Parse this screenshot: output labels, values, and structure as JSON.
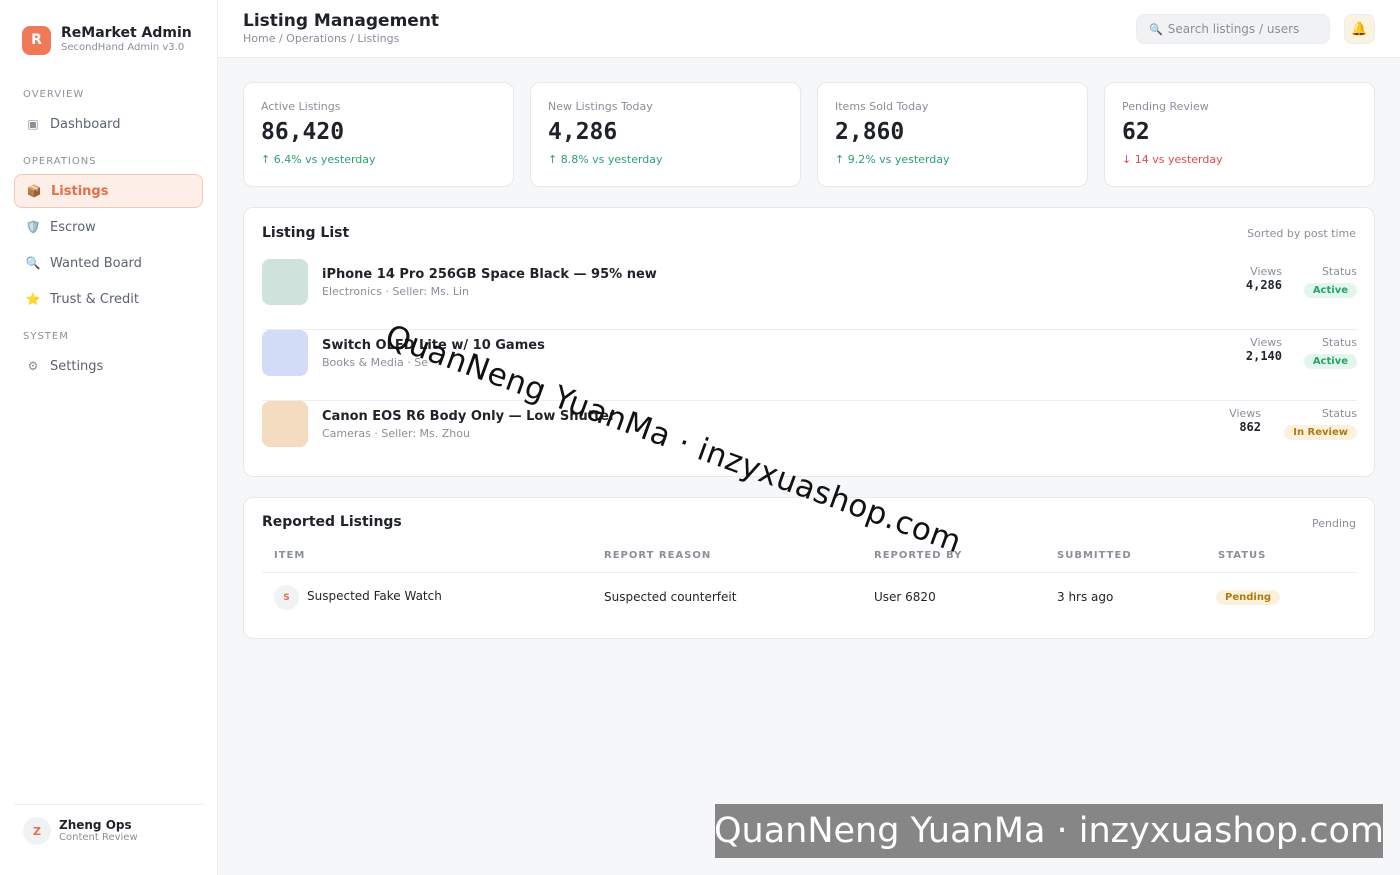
{
  "brand": {
    "logo_letter": "R",
    "name": "ReMarket Admin",
    "subtitle": "SecondHand Admin v3.0"
  },
  "sidebar": {
    "sections": [
      "OVERVIEW",
      "OPERATIONS",
      "SYSTEM"
    ],
    "items": [
      {
        "label": "Dashboard",
        "icon": "dashboard-icon",
        "glyph": "▣"
      },
      {
        "label": "Listings",
        "icon": "package-icon",
        "glyph": "📦",
        "active": true
      },
      {
        "label": "Escrow",
        "icon": "shield-icon",
        "glyph": "🛡️"
      },
      {
        "label": "Wanted Board",
        "icon": "search-icon",
        "glyph": "🔍"
      },
      {
        "label": "Trust & Credit",
        "icon": "star-icon",
        "glyph": "⭐"
      },
      {
        "label": "Settings",
        "icon": "gear-icon",
        "glyph": "⚙"
      }
    ],
    "user": {
      "initial": "Z",
      "name": "Zheng Ops",
      "role": "Content Review"
    }
  },
  "header": {
    "title": "Listing Management",
    "breadcrumb": "Home / Operations / Listings",
    "search_placeholder": "Search listings / users",
    "search_glyph": "🔍",
    "bell_glyph": "🔔"
  },
  "stats": [
    {
      "label": "Active Listings",
      "value": "86,420",
      "delta": "↑ 6.4% vs yesterday",
      "trend": "up"
    },
    {
      "label": "New Listings Today",
      "value": "4,286",
      "delta": "↑ 8.8% vs yesterday",
      "trend": "up"
    },
    {
      "label": "Items Sold Today",
      "value": "2,860",
      "delta": "↑ 9.2% vs yesterday",
      "trend": "up"
    },
    {
      "label": "Pending Review",
      "value": "62",
      "delta": "↓ 14 vs yesterday",
      "trend": "down"
    }
  ],
  "listing_list": {
    "title": "Listing List",
    "meta": "Sorted by post time",
    "views_label": "Views",
    "status_label": "Status",
    "rows": [
      {
        "title": "iPhone 14 Pro 256GB Space Black — 95% new",
        "sub": "Electronics · Seller: Ms. Lin",
        "views": "4,286",
        "status": "Active",
        "status_type": "active",
        "thumb_color": "#cfe3dc"
      },
      {
        "title": "Switch OLED Lite w/ 10 Games",
        "sub": "Books & Media · Se",
        "views": "2,140",
        "status": "Active",
        "status_type": "active",
        "thumb_color": "#d3dcf6"
      },
      {
        "title": "Canon EOS R6 Body Only — Low Shutter",
        "sub": "Cameras · Seller: Ms. Zhou",
        "views": "862",
        "status": "In Review",
        "status_type": "review",
        "thumb_color": "#f3dcc0"
      }
    ]
  },
  "reported": {
    "title": "Reported Listings",
    "meta": "Pending",
    "columns": [
      "ITEM",
      "REPORT REASON",
      "REPORTED BY",
      "SUBMITTED",
      "STATUS"
    ],
    "rows": [
      {
        "initial": "S",
        "item": "Suspected Fake Watch",
        "reason": "Suspected counterfeit",
        "by": "User 6820",
        "submitted": "3 hrs ago",
        "status": "Pending"
      }
    ]
  },
  "watermark": {
    "text": "QuanNeng YuanMa · inzyxuashop.com"
  }
}
